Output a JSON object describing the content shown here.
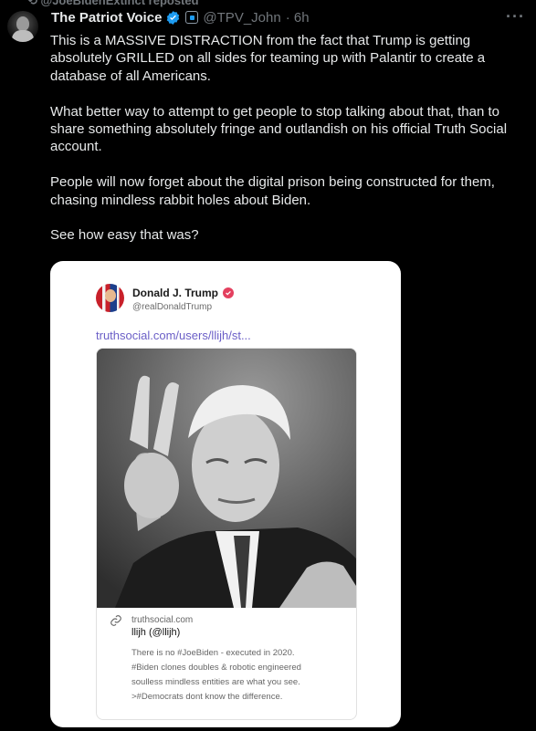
{
  "repost": {
    "label": "@JoeBidenExtinct reposted"
  },
  "post": {
    "author_name": "The Patriot Voice",
    "handle": "@TPV_John",
    "time": "· 6h",
    "more_label": "···",
    "paragraphs": [
      "This is a MASSIVE DISTRACTION from the fact that Trump is getting absolutely GRILLED on all sides for teaming up with Palantir to create a database of all Americans.",
      "What better way to attempt to get people to stop talking about that, than to share something absolutely fringe and outlandish on his official Truth Social account.",
      "People will now forget about the digital prison being constructed for them, chasing mindless rabbit holes about Biden.",
      "See how easy that was?"
    ]
  },
  "embed": {
    "author_name": "Donald J. Trump",
    "handle": "@realDonaldTrump",
    "link": "truthsocial.com/users/llijh/st...",
    "preview": {
      "link_icon": "link-icon",
      "domain": "truthsocial.com",
      "title": "llijh (@llijh)",
      "description_lines": [
        "There is no #JoeBiden - executed in 2020.",
        "#Biden clones doubles & robotic engineered",
        "soulless mindless entities are what you see.",
        ">#Democrats dont know the difference."
      ]
    }
  },
  "colors": {
    "background": "#000000",
    "text": "#e7e9ea",
    "secondary": "#71767b",
    "verified_blue": "#1d9bf0",
    "truth_link": "#6b5fc7",
    "truth_badge": "#e4405f"
  }
}
